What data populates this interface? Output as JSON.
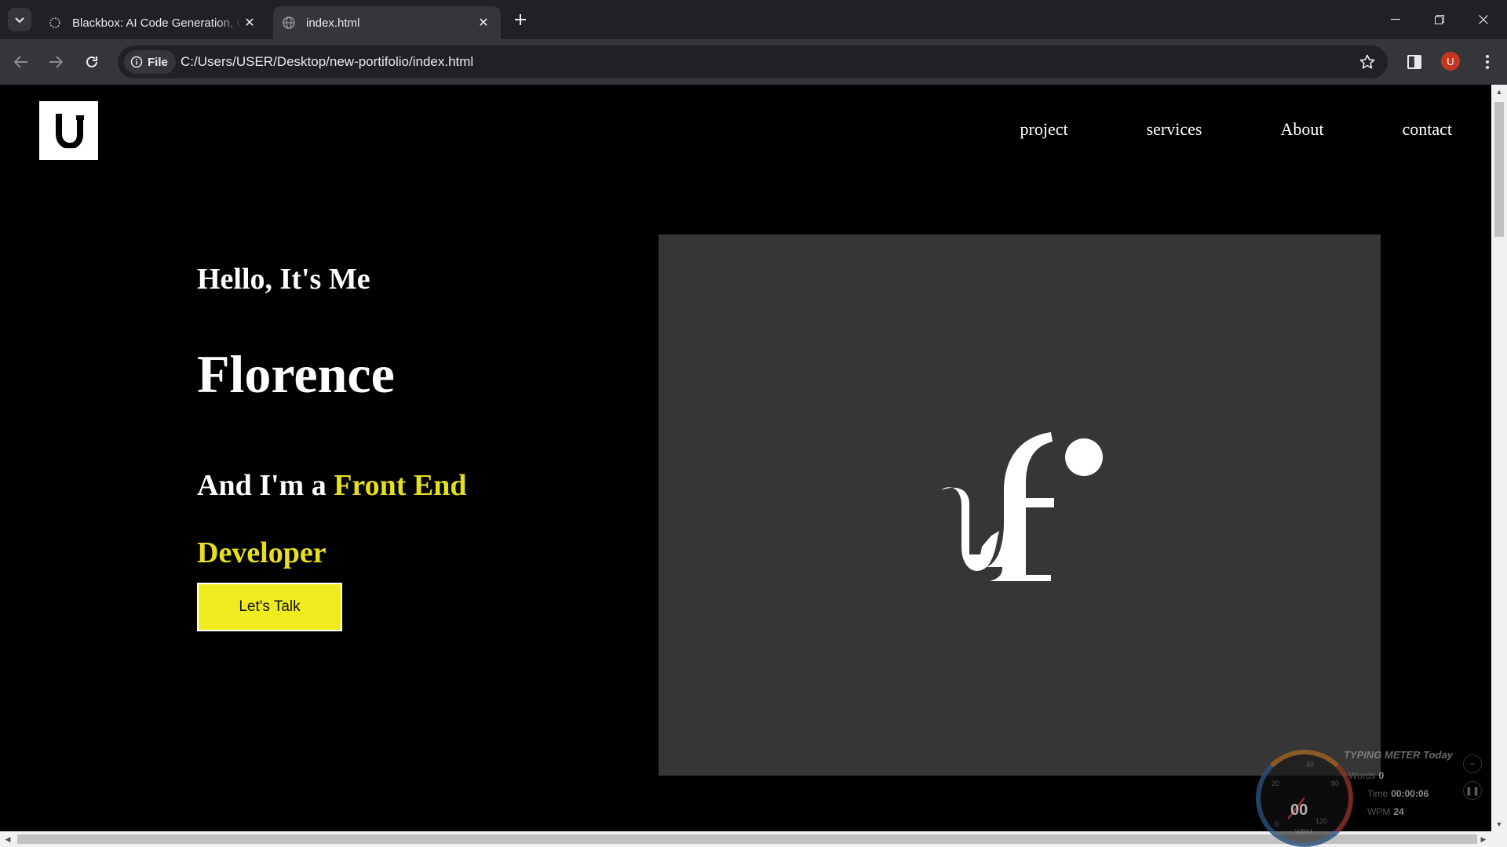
{
  "browser": {
    "tabs": [
      {
        "title": "Blackbox: AI Code Generation, C",
        "favicon": "blackbox-icon",
        "active": false
      },
      {
        "title": "index.html",
        "favicon": "globe-icon",
        "active": true
      }
    ],
    "address": {
      "chip_label": "File",
      "url": "C:/Users/USER/Desktop/new-portifolio/index.html"
    },
    "profile_initial": "U"
  },
  "site": {
    "logo_letter": "U",
    "nav": [
      "project",
      "services",
      "About",
      "contact"
    ],
    "hero": {
      "greeting": "Hello, It's Me",
      "name": "Florence",
      "role_prefix": "And I'm a ",
      "role_highlight": "Front End Developer",
      "cta_label": "Let's Talk",
      "image_mark": "uf-logo"
    },
    "colors": {
      "accent": "#eeec1e",
      "background": "#000000",
      "image_panel": "#363636"
    }
  },
  "typing_meter": {
    "title": "TYPING METER Today",
    "words_label": "Words",
    "words_value": "0",
    "time_label": "Time",
    "time_value": "00:00:06",
    "wpm_label": "WPM",
    "wpm_value": "24",
    "gauge_value": "00",
    "gauge_unit": "WPM",
    "gauge_ticks": [
      "0",
      "20",
      "40",
      "80",
      "120"
    ]
  }
}
